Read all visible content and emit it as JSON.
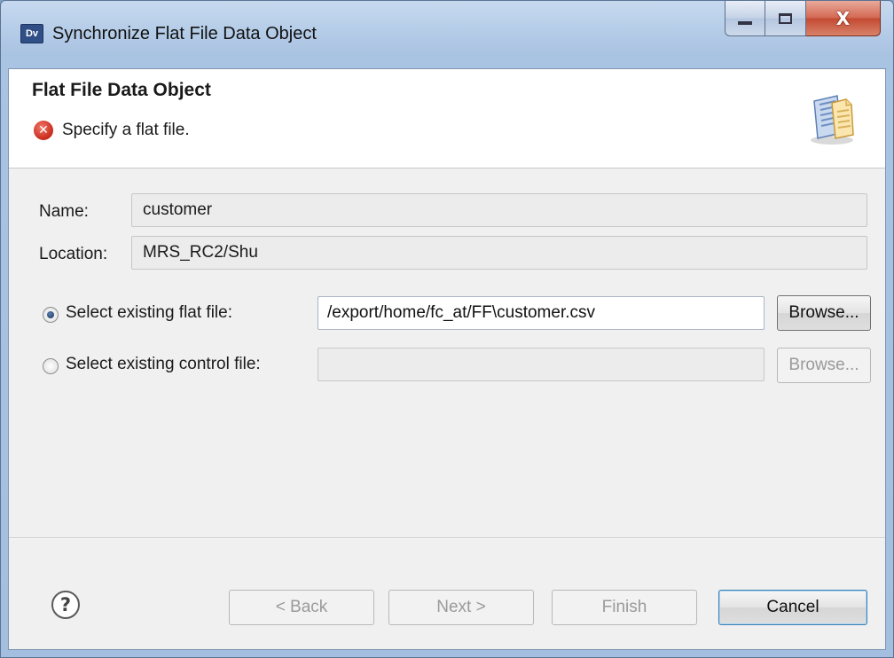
{
  "window": {
    "app_icon_text": "Dv",
    "title": "Synchronize Flat File Data Object",
    "close_glyph": "X"
  },
  "banner": {
    "title": "Flat File Data Object",
    "error_message": "Specify a flat file.",
    "error_icon_glyph": "✕"
  },
  "form": {
    "name_label": "Name:",
    "name_value": "customer",
    "location_label": "Location:",
    "location_value": "MRS_RC2/Shu",
    "flat_file_option": {
      "label": "Select existing flat file:",
      "selected": true,
      "value": "/export/home/fc_at/FF\\customer.csv",
      "browse_label": "Browse..."
    },
    "control_file_option": {
      "label": "Select existing control file:",
      "selected": false,
      "value": "",
      "browse_label": "Browse..."
    }
  },
  "footer": {
    "help_glyph": "?",
    "back_label": "< Back",
    "next_label": "Next >",
    "finish_label": "Finish",
    "cancel_label": "Cancel"
  },
  "icons": [
    "app-icon",
    "minimize-icon",
    "maximize-icon",
    "close-icon",
    "error-icon",
    "wizard-icon",
    "help-icon"
  ]
}
